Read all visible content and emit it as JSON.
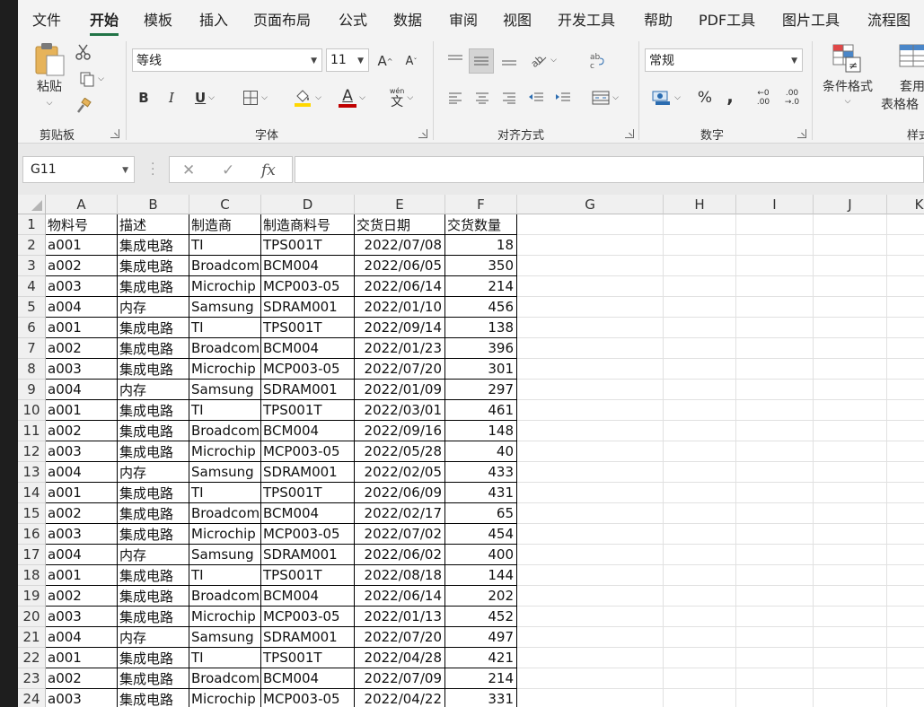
{
  "tabs": [
    "文件",
    "开始",
    "模板",
    "插入",
    "页面布局",
    "公式",
    "数据",
    "审阅",
    "视图",
    "开发工具",
    "帮助",
    "PDF工具",
    "图片工具",
    "流程图"
  ],
  "active_tab": "开始",
  "ribbon": {
    "clipboard": {
      "paste_label": "粘贴",
      "group_label": "剪贴板"
    },
    "font": {
      "name": "等线",
      "size": "11",
      "grow_label": "A",
      "shrink_label": "A",
      "bold": "B",
      "italic": "I",
      "underline": "U",
      "font_color_letter": "A",
      "phonetic_label": "wén",
      "phonetic_char": "文",
      "group_label": "字体"
    },
    "alignment": {
      "group_label": "对齐方式"
    },
    "number": {
      "format": "常规",
      "percent": "%",
      "comma": ",",
      "increase_decimal_top": "←0",
      "increase_decimal_bottom": ".00",
      "decrease_decimal_top": ".00",
      "decrease_decimal_bottom": "→.0",
      "group_label": "数字"
    },
    "styles": {
      "conditional_label": "条件格式",
      "table_label_1": "套用",
      "table_label_2": "表格格",
      "group_label": "样式"
    }
  },
  "formula_bar": {
    "name_box": "G11",
    "fx_label": "fx",
    "value": ""
  },
  "columns": [
    "A",
    "B",
    "C",
    "D",
    "E",
    "F",
    "G",
    "H",
    "I",
    "J",
    "K"
  ],
  "rows": [
    {
      "n": "1",
      "cells": [
        "物料号",
        "描述",
        "制造商",
        "制造商料号",
        "交货日期",
        "交货数量"
      ]
    },
    {
      "n": "2",
      "cells": [
        "a001",
        "集成电路",
        "TI",
        "TPS001T",
        "2022/07/08",
        "18"
      ]
    },
    {
      "n": "3",
      "cells": [
        "a002",
        "集成电路",
        "Broadcom",
        "BCM004",
        "2022/06/05",
        "350"
      ]
    },
    {
      "n": "4",
      "cells": [
        "a003",
        "集成电路",
        "Microchip",
        "MCP003-05",
        "2022/06/14",
        "214"
      ]
    },
    {
      "n": "5",
      "cells": [
        "a004",
        "内存",
        "Samsung",
        "SDRAM001",
        "2022/01/10",
        "456"
      ]
    },
    {
      "n": "6",
      "cells": [
        "a001",
        "集成电路",
        "TI",
        "TPS001T",
        "2022/09/14",
        "138"
      ]
    },
    {
      "n": "7",
      "cells": [
        "a002",
        "集成电路",
        "Broadcom",
        "BCM004",
        "2022/01/23",
        "396"
      ]
    },
    {
      "n": "8",
      "cells": [
        "a003",
        "集成电路",
        "Microchip",
        "MCP003-05",
        "2022/07/20",
        "301"
      ]
    },
    {
      "n": "9",
      "cells": [
        "a004",
        "内存",
        "Samsung",
        "SDRAM001",
        "2022/01/09",
        "297"
      ]
    },
    {
      "n": "10",
      "cells": [
        "a001",
        "集成电路",
        "TI",
        "TPS001T",
        "2022/03/01",
        "461"
      ]
    },
    {
      "n": "11",
      "cells": [
        "a002",
        "集成电路",
        "Broadcom",
        "BCM004",
        "2022/09/16",
        "148"
      ]
    },
    {
      "n": "12",
      "cells": [
        "a003",
        "集成电路",
        "Microchip",
        "MCP003-05",
        "2022/05/28",
        "40"
      ]
    },
    {
      "n": "13",
      "cells": [
        "a004",
        "内存",
        "Samsung",
        "SDRAM001",
        "2022/02/05",
        "433"
      ]
    },
    {
      "n": "14",
      "cells": [
        "a001",
        "集成电路",
        "TI",
        "TPS001T",
        "2022/06/09",
        "431"
      ]
    },
    {
      "n": "15",
      "cells": [
        "a002",
        "集成电路",
        "Broadcom",
        "BCM004",
        "2022/02/17",
        "65"
      ]
    },
    {
      "n": "16",
      "cells": [
        "a003",
        "集成电路",
        "Microchip",
        "MCP003-05",
        "2022/07/02",
        "454"
      ]
    },
    {
      "n": "17",
      "cells": [
        "a004",
        "内存",
        "Samsung",
        "SDRAM001",
        "2022/06/02",
        "400"
      ]
    },
    {
      "n": "18",
      "cells": [
        "a001",
        "集成电路",
        "TI",
        "TPS001T",
        "2022/08/18",
        "144"
      ]
    },
    {
      "n": "19",
      "cells": [
        "a002",
        "集成电路",
        "Broadcom",
        "BCM004",
        "2022/06/14",
        "202"
      ]
    },
    {
      "n": "20",
      "cells": [
        "a003",
        "集成电路",
        "Microchip",
        "MCP003-05",
        "2022/01/13",
        "452"
      ]
    },
    {
      "n": "21",
      "cells": [
        "a004",
        "内存",
        "Samsung",
        "SDRAM001",
        "2022/07/20",
        "497"
      ]
    },
    {
      "n": "22",
      "cells": [
        "a001",
        "集成电路",
        "TI",
        "TPS001T",
        "2022/04/28",
        "421"
      ]
    },
    {
      "n": "23",
      "cells": [
        "a002",
        "集成电路",
        "Broadcom",
        "BCM004",
        "2022/07/09",
        "214"
      ]
    },
    {
      "n": "24",
      "cells": [
        "a003",
        "集成电路",
        "Microchip",
        "MCP003-05",
        "2022/04/22",
        "331"
      ]
    }
  ],
  "colors": {
    "accent": "#217346",
    "highlight_yellow": "#ffd700",
    "font_red": "#c00000"
  }
}
